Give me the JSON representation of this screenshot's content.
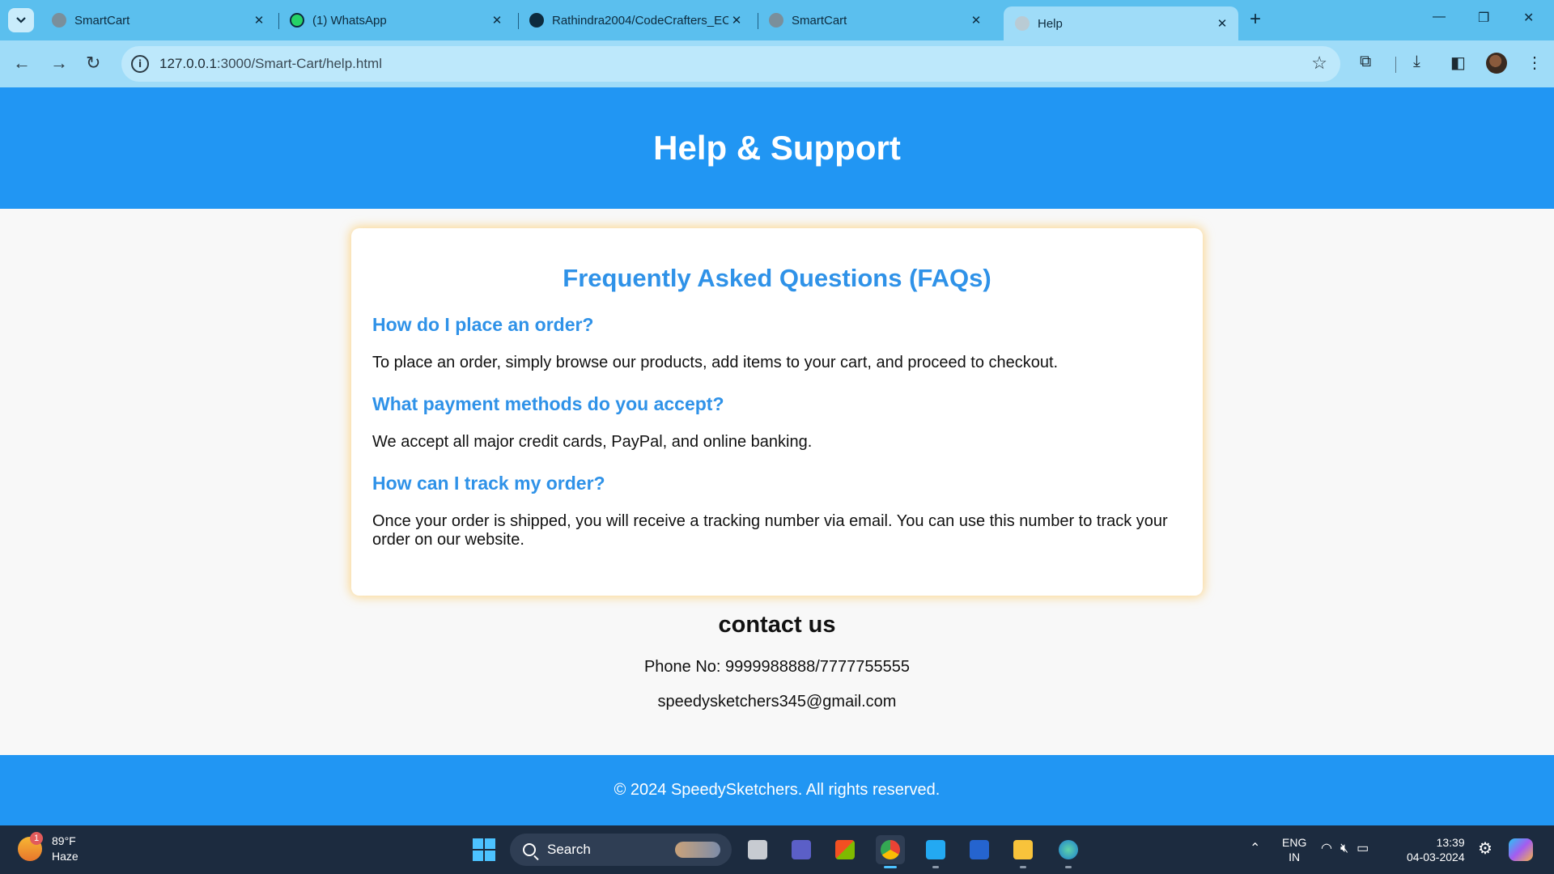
{
  "browser": {
    "tabs": [
      {
        "title": "SmartCart",
        "icon": "globe-icon",
        "active": false
      },
      {
        "title": "(1) WhatsApp",
        "icon": "whatsapp-icon",
        "active": false
      },
      {
        "title": "Rathindra2004/CodeCrafters_EC",
        "icon": "github-icon",
        "active": false
      },
      {
        "title": "SmartCart",
        "icon": "globe-icon",
        "active": false
      },
      {
        "title": "Help",
        "icon": "globe-icon",
        "active": true
      }
    ],
    "url_host": "127.0.0.1",
    "url_path": ":3000/Smart-Cart/help.html",
    "theme_color": "#5bbfee",
    "toolbar_color": "#9fdcf8"
  },
  "page": {
    "header_title": "Help & Support",
    "faq": {
      "heading": "Frequently Asked Questions (FAQs)",
      "items": [
        {
          "question": "How do I place an order?",
          "answer": "To place an order, simply browse our products, add items to your cart, and proceed to checkout."
        },
        {
          "question": "What payment methods do you accept?",
          "answer": "We accept all major credit cards, PayPal, and online banking."
        },
        {
          "question": "How can I track my order?",
          "answer": "Once your order is shipped, you will receive a tracking number via email. You can use this number to track your order on our website."
        }
      ]
    },
    "contact": {
      "heading": "contact us",
      "phone": "Phone No: 9999988888/7777755555",
      "email": "speedysketchers345@gmail.com"
    },
    "footer": "© 2024 SpeedySketchers. All rights reserved.",
    "accent_color": "#2196f3",
    "faq_heading_color": "#2f92e8"
  },
  "taskbar": {
    "weather_temp": "89°F",
    "weather_desc": "Haze",
    "weather_badge": "1",
    "search_label": "Search",
    "lang_line1": "ENG",
    "lang_line2": "IN",
    "time": "13:39",
    "date": "04-03-2024",
    "apps": [
      "file-manager-icon",
      "teams-icon",
      "store-icon",
      "chrome-icon",
      "vscode-icon",
      "todo-icon",
      "file-explorer-icon",
      "globe-app-icon"
    ]
  }
}
